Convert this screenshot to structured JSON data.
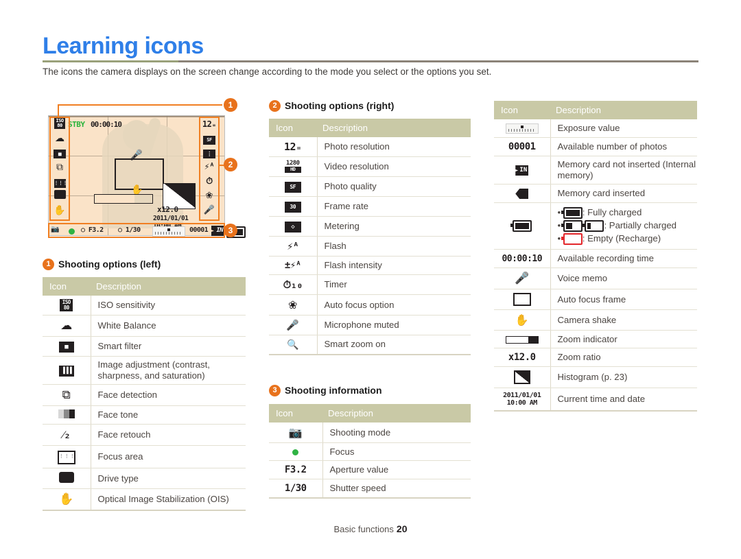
{
  "page": {
    "title": "Learning icons",
    "subtitle": "The icons the camera displays on the screen change according to the mode you select or the options you set.",
    "footer_label": "Basic functions",
    "footer_page": "20",
    "accent_orange": "#E8721C",
    "title_blue": "#2F7FE8",
    "table_header_bg": "#C9C9A6"
  },
  "camera_screen": {
    "stby_label": "STBY",
    "record_time": "00:00:10",
    "zoom_ratio": "x12.0",
    "date": "2011/01/01",
    "time": "10:00 AM",
    "bottom_bar": {
      "shooting_mode": "camera-P",
      "focus": "green-dot",
      "aperture": "F3.2",
      "shutter": "1/30",
      "exposure": "exposure-scale",
      "photos_remaining": "00001",
      "memory": "internal-memory",
      "battery": "battery-full"
    },
    "left_icons": [
      "iso-icon",
      "white-balance-icon",
      "smart-filter-icon",
      "face-detection-icon",
      "focus-area-icon",
      "drive-type-icon",
      "ois-icon"
    ],
    "right_icons": [
      "photo-resolution-icon",
      "photo-quality-icon",
      "metering-icon",
      "flash-icon",
      "timer-icon",
      "macro-icon",
      "mic-muted-icon"
    ],
    "callouts": [
      "1",
      "2",
      "3"
    ]
  },
  "sections": [
    {
      "badge": "1",
      "heading": "Shooting options (left)",
      "columns": [
        "Icon",
        "Description"
      ],
      "rows": [
        {
          "icon": "iso-icon",
          "desc": "ISO sensitivity"
        },
        {
          "icon": "white-balance-icon",
          "desc": "White Balance"
        },
        {
          "icon": "smart-filter-icon",
          "desc": "Smart filter"
        },
        {
          "icon": "image-adjustment-icon",
          "desc": "Image adjustment (contrast, sharpness, and saturation)"
        },
        {
          "icon": "face-detection-icon",
          "desc": "Face detection"
        },
        {
          "icon": "face-tone-icon",
          "desc": "Face tone"
        },
        {
          "icon": "face-retouch-icon",
          "desc": "Face retouch"
        },
        {
          "icon": "focus-area-icon",
          "desc": "Focus area"
        },
        {
          "icon": "drive-type-icon",
          "desc": "Drive type"
        },
        {
          "icon": "ois-icon",
          "desc": "Optical Image Stabilization (OIS)"
        }
      ]
    },
    {
      "badge": "2",
      "heading": "Shooting options (right)",
      "columns": [
        "Icon",
        "Description"
      ],
      "rows": [
        {
          "icon": "photo-resolution-icon",
          "desc": "Photo resolution"
        },
        {
          "icon": "video-resolution-icon",
          "desc": "Video resolution"
        },
        {
          "icon": "photo-quality-icon",
          "desc": "Photo quality"
        },
        {
          "icon": "frame-rate-icon",
          "desc": "Frame rate"
        },
        {
          "icon": "metering-icon",
          "desc": "Metering"
        },
        {
          "icon": "flash-icon",
          "desc": "Flash"
        },
        {
          "icon": "flash-intensity-icon",
          "desc": "Flash intensity"
        },
        {
          "icon": "timer-icon",
          "desc": "Timer"
        },
        {
          "icon": "auto-focus-option-icon",
          "desc": "Auto focus option"
        },
        {
          "icon": "mic-muted-icon",
          "desc": "Microphone muted"
        },
        {
          "icon": "smart-zoom-icon",
          "desc": "Smart zoom on"
        }
      ]
    },
    {
      "badge": "3",
      "heading": "Shooting information",
      "columns": [
        "Icon",
        "Description"
      ],
      "rows": [
        {
          "icon": "shooting-mode-icon",
          "desc": "Shooting mode"
        },
        {
          "icon": "focus-dot-icon",
          "desc": "Focus"
        },
        {
          "icon": "aperture-icon",
          "desc": "Aperture value"
        },
        {
          "icon": "shutter-speed-icon",
          "desc": "Shutter speed"
        }
      ]
    }
  ],
  "right_table": {
    "columns": [
      "Icon",
      "Description"
    ],
    "rows": [
      {
        "icon": "exposure-value-icon",
        "desc": "Exposure value"
      },
      {
        "icon": "photo-count-icon",
        "desc": "Available number of photos"
      },
      {
        "icon": "internal-memory-icon",
        "desc": "Memory card not inserted (Internal memory)"
      },
      {
        "icon": "memory-card-icon",
        "desc": "Memory card inserted"
      },
      {
        "icon": "battery-icon",
        "desc": "",
        "bullets": [
          ": Fully charged",
          ": Partially charged",
          ": Empty (Recharge)"
        ]
      },
      {
        "icon": "recording-time-icon",
        "desc": "Available recording time"
      },
      {
        "icon": "voice-memo-icon",
        "desc": "Voice memo"
      },
      {
        "icon": "auto-focus-frame-icon",
        "desc": "Auto focus frame"
      },
      {
        "icon": "camera-shake-icon",
        "desc": "Camera shake"
      },
      {
        "icon": "zoom-indicator-icon",
        "desc": "Zoom indicator"
      },
      {
        "icon": "zoom-ratio-icon",
        "desc": "Zoom ratio"
      },
      {
        "icon": "histogram-icon",
        "desc": "Histogram (p. 23)"
      },
      {
        "icon": "current-time-date-icon",
        "desc": "Current time and date"
      }
    ],
    "icon_values": {
      "photo_count": "00001",
      "recording_time": "00:00:10",
      "zoom_ratio": "x12.0",
      "date": "2011/01/01",
      "time": "10:00 AM"
    }
  }
}
